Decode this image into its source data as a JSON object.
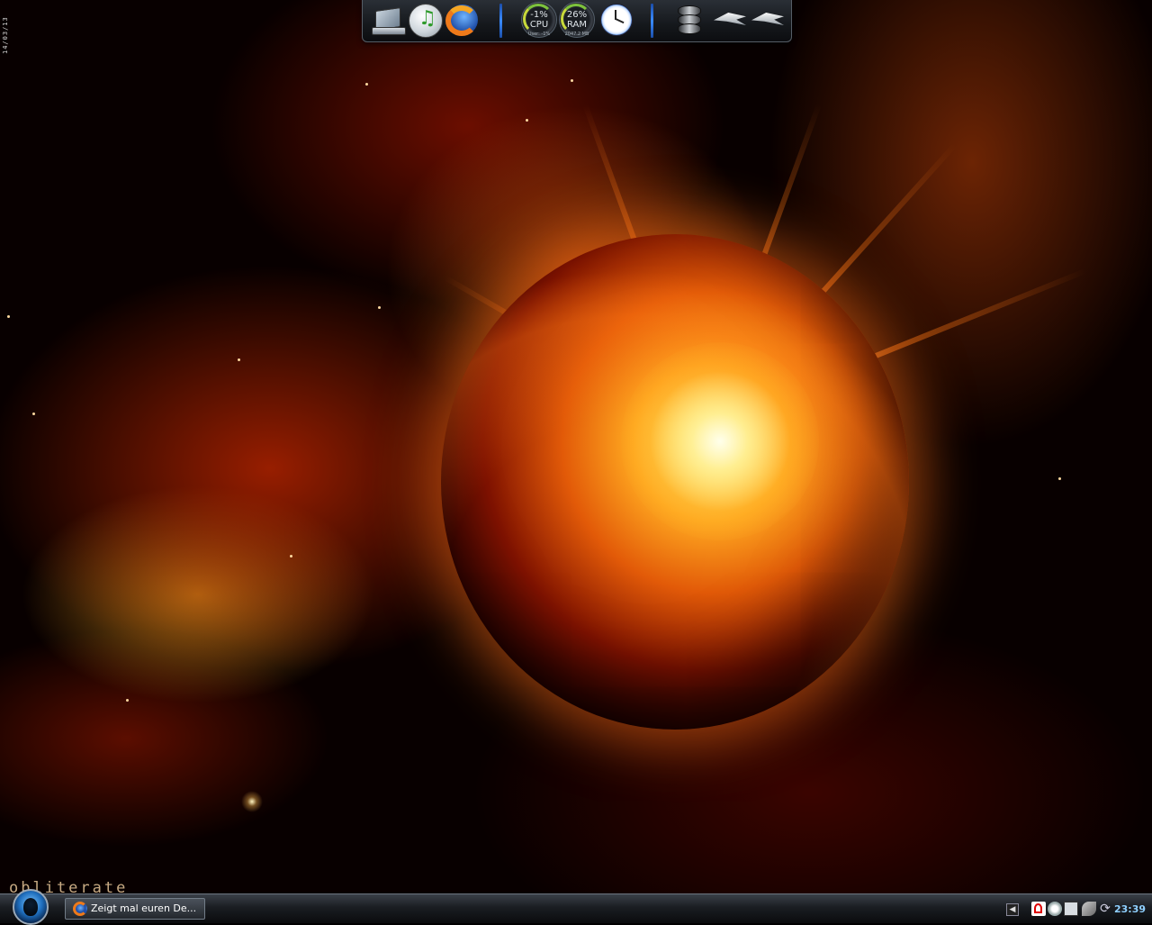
{
  "desktop": {
    "vertical_text": "14/03/13",
    "watermark": "obliterate"
  },
  "dock": {
    "items": [
      {
        "name": "my-computer",
        "icon": "computer-icon"
      },
      {
        "name": "itunes",
        "icon": "itunes-icon"
      },
      {
        "name": "firefox",
        "icon": "firefox-icon"
      }
    ],
    "cpu": {
      "value": "-1%",
      "label": "CPU",
      "sub": "User: -1%"
    },
    "ram": {
      "value": "26%",
      "label": "RAM",
      "sub": "2047.2 MB"
    },
    "clock_icon": "clock-icon",
    "utility_icons": [
      "database-icon",
      "plane-icon",
      "plane-icon"
    ]
  },
  "taskbar": {
    "start_icon": "alien-orb-icon",
    "tasks": [
      {
        "label": "Zeigt mal euren De...",
        "icon": "firefox-icon"
      }
    ],
    "tray_toggle": "◀",
    "tray_icons": [
      "antivirus-icon",
      "steam-icon",
      "monitor-icon",
      "network-icon",
      "sync-icon"
    ],
    "sync_glyph": "⟳",
    "clock": "23:39"
  },
  "colors": {
    "accent_blue": "#3a8cff",
    "clock_text": "#8fd0ff",
    "wallpaper_fire": "#ff7a1a"
  }
}
